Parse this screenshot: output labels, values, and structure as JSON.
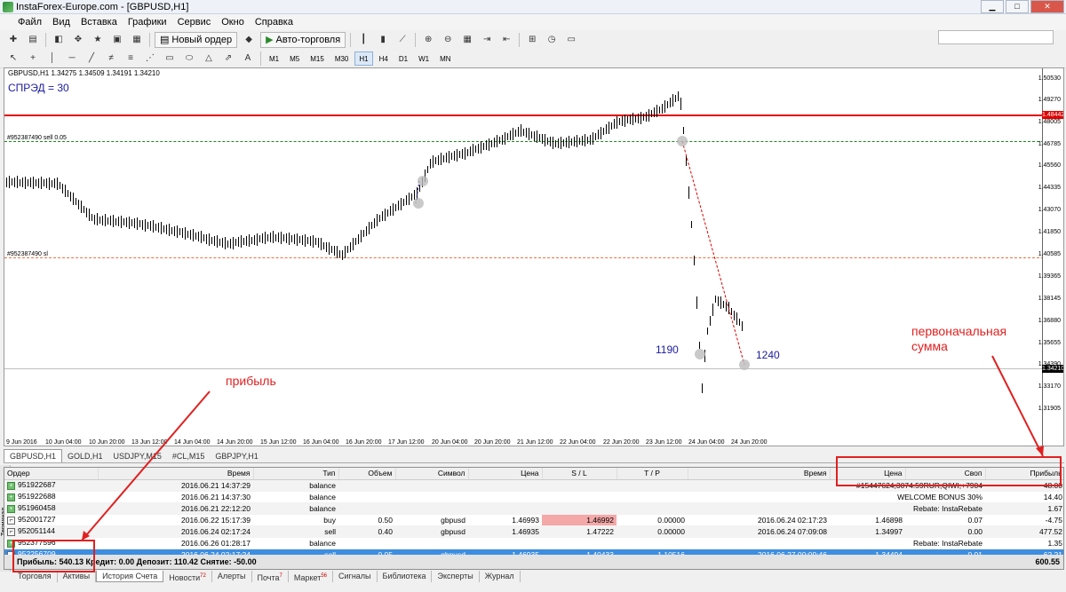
{
  "window": {
    "title": "InstaForex-Europe.com - [GBPUSD,H1]"
  },
  "menu": [
    "Файл",
    "Вид",
    "Вставка",
    "Графики",
    "Сервис",
    "Окно",
    "Справка"
  ],
  "toolbar": {
    "new_order": "Новый ордер",
    "auto_trading": "Авто-торговля"
  },
  "timeframes": [
    "M1",
    "M5",
    "M15",
    "M30",
    "H1",
    "H4",
    "D1",
    "W1",
    "MN"
  ],
  "chart": {
    "info": "GBPUSD,H1  1.34275 1.34509 1.34191 1.34210",
    "spread": "СПРЭД = 30",
    "order_sell_label": "#952387490 sell 0.05",
    "order_sl_label": "#952387490 sl",
    "marker_1190": "1190",
    "marker_1240": "1240",
    "price_labels": [
      "1.50530",
      "1.49270",
      "1.48005",
      "1.46785",
      "1.45560",
      "1.44335",
      "1.43070",
      "1.41850",
      "1.40585",
      "1.39365",
      "1.38145",
      "1.36880",
      "1.35655",
      "1.34390",
      "1.33170",
      "1.31905"
    ],
    "tag_red": "1.48442",
    "tag_last": "1.34210",
    "time_labels": [
      "9 Jun 2016",
      "10 Jun 04:00",
      "10 Jun 20:00",
      "13 Jun 12:00",
      "14 Jun 04:00",
      "14 Jun 20:00",
      "15 Jun 12:00",
      "16 Jun 04:00",
      "16 Jun 20:00",
      "17 Jun 12:00",
      "20 Jun 04:00",
      "20 Jun 20:00",
      "21 Jun 12:00",
      "22 Jun 04:00",
      "22 Jun 20:00",
      "23 Jun 12:00",
      "24 Jun 04:00",
      "24 Jun 20:00"
    ],
    "colors": {
      "red_line": "#e00000",
      "green_dash": "#1a8a1a",
      "orange_dash": "#f07040"
    }
  },
  "chart_tabs": [
    "GBPUSD,H1",
    "GOLD,H1",
    "USDJPY,M15",
    "#CL,M15",
    "GBPJPY,H1"
  ],
  "history": {
    "headers": [
      "Ордер",
      "Время",
      "Тип",
      "Объем",
      "Символ",
      "Цена",
      "S / L",
      "T / P",
      "Время",
      "Цена",
      "Своп",
      "Прибыль"
    ],
    "rows": [
      {
        "order": "951922687",
        "time": "2016.06.21 14:37:29",
        "type": "balance",
        "comment": "#15447624;3074.59RUR;QIWI;+7904",
        "profit": "48.00"
      },
      {
        "order": "951922688",
        "time": "2016.06.21 14:37:30",
        "type": "balance",
        "comment": "WELCOME BONUS 30%",
        "profit": "14.40"
      },
      {
        "order": "951960458",
        "time": "2016.06.21 22:12:20",
        "type": "balance",
        "comment": "Rebate: InstaRebate",
        "profit": "1.67"
      },
      {
        "order": "952001727",
        "time": "2016.06.22 15:17:39",
        "type": "buy",
        "volume": "0.50",
        "symbol": "gbpusd",
        "price": "1.46993",
        "sl": "1.46992",
        "tp": "0.00000",
        "ctime": "2016.06.24 02:17:23",
        "cprice": "1.46898",
        "swap": "0.07",
        "profit": "-4.75"
      },
      {
        "order": "952051144",
        "time": "2016.06.24 02:17:24",
        "type": "sell",
        "volume": "0.40",
        "symbol": "gbpusd",
        "price": "1.46935",
        "sl": "1.47222",
        "tp": "0.00000",
        "ctime": "2016.06.24 07:09:08",
        "cprice": "1.34997",
        "swap": "0.00",
        "profit": "477.52"
      },
      {
        "order": "952377596",
        "time": "2016.06.26 01:28:17",
        "type": "balance",
        "comment": "Rebate: InstaRebate",
        "profit": "1.35"
      },
      {
        "order": "952256709",
        "time": "2016.06.24 02:17:24",
        "type": "sell",
        "volume": "0.05",
        "symbol": "gbpusd",
        "price": "1.46935",
        "sl": "1.40433",
        "tp": "1.10516",
        "ctime": "2016.06.27 00:09:46",
        "cprice": "1.34494",
        "swap": "-0.01",
        "profit": "62.21"
      }
    ],
    "summary": {
      "text": "Прибыль: 540.13  Кредит: 0.00  Депозит: 110.42  Снятие: -50.00",
      "total": "600.55"
    }
  },
  "bottom_tabs": [
    {
      "label": "Торговля"
    },
    {
      "label": "Активы"
    },
    {
      "label": "История Счета"
    },
    {
      "label": "Новости",
      "badge": "72"
    },
    {
      "label": "Алерты"
    },
    {
      "label": "Почта",
      "badge": "7"
    },
    {
      "label": "Маркет",
      "badge": "56"
    },
    {
      "label": "Сигналы"
    },
    {
      "label": "Библиотека"
    },
    {
      "label": "Эксперты"
    },
    {
      "label": "Журнал"
    }
  ],
  "terminal_side": "Терминал",
  "annotations": {
    "profit": "прибыль",
    "initial": "первоначальная\nсумма"
  }
}
